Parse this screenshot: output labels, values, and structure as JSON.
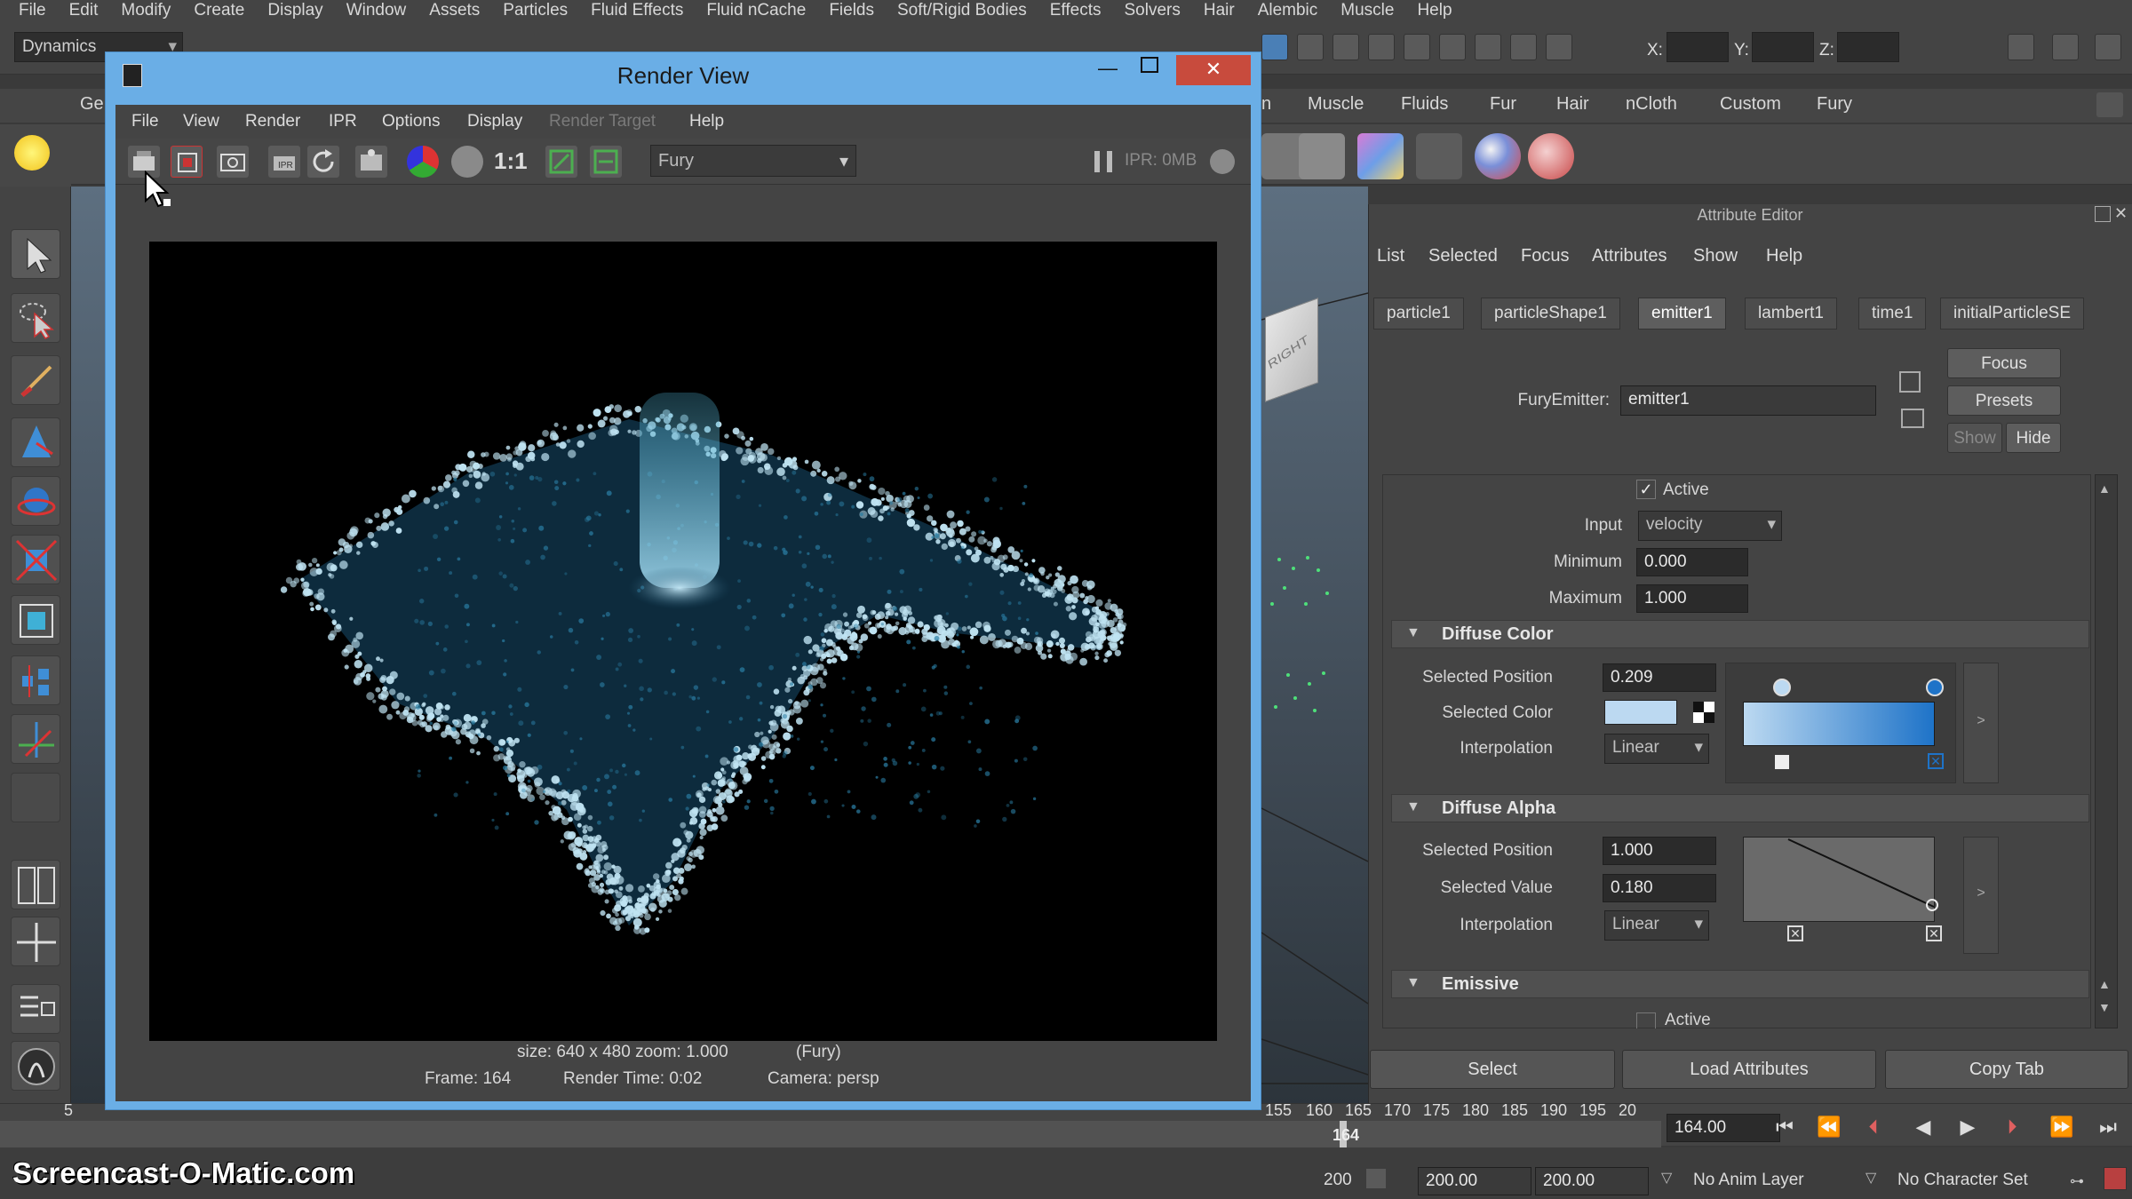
{
  "main_menu": [
    "File",
    "Edit",
    "Modify",
    "Create",
    "Display",
    "Window",
    "Assets",
    "Particles",
    "Fluid Effects",
    "Fluid nCache",
    "Fields",
    "Soft/Rigid Bodies",
    "Effects",
    "Solvers",
    "Hair",
    "Alembic",
    "Muscle",
    "Help"
  ],
  "status_line": {
    "menu_set": "Dynamics",
    "x_label": "X:",
    "y_label": "Y:",
    "z_label": "Z:"
  },
  "shelf_tabs": [
    "Ge",
    "n",
    "Muscle",
    "Fluids",
    "Fur",
    "Hair",
    "nCloth",
    "Custom",
    "Fury"
  ],
  "render_view": {
    "title": "Render View",
    "menu": [
      "File",
      "View",
      "Render",
      "IPR",
      "Options",
      "Display",
      "Render Target",
      "Help"
    ],
    "ratio_label": "1:1",
    "renderer": "Fury",
    "ipr_status": "IPR: 0MB",
    "info_line1_size": "size: 640 x 480 zoom: 1.000",
    "info_line1_renderer": "(Fury)",
    "info_frame": "Frame: 164",
    "info_render_time": "Render Time: 0:02",
    "info_camera": "Camera: persp"
  },
  "viewcube_label": "RIGHT",
  "attribute_editor": {
    "title": "Attribute Editor",
    "menu": [
      "List",
      "Selected",
      "Focus",
      "Attributes",
      "Show",
      "Help"
    ],
    "tabs": [
      "particle1",
      "particleShape1",
      "emitter1",
      "lambert1",
      "time1",
      "initialParticleSE"
    ],
    "active_tab": "emitter1",
    "node_type_label": "FuryEmitter:",
    "node_name": "emitter1",
    "focus_button": "Focus",
    "presets_button": "Presets",
    "show_button": "Show",
    "hide_button": "Hide",
    "active_label": "Active",
    "input_label": "Input",
    "input_value": "velocity",
    "minimum_label": "Minimum",
    "minimum_value": "0.000",
    "maximum_label": "Maximum",
    "maximum_value": "1.000",
    "diffuse_color": {
      "section": "Diffuse Color",
      "sel_pos_label": "Selected Position",
      "sel_pos_value": "0.209",
      "sel_color_label": "Selected Color",
      "interp_label": "Interpolation",
      "interp_value": "Linear"
    },
    "diffuse_alpha": {
      "section": "Diffuse Alpha",
      "sel_pos_label": "Selected Position",
      "sel_pos_value": "1.000",
      "sel_val_label": "Selected Value",
      "sel_val_value": "0.180",
      "interp_label": "Interpolation",
      "interp_value": "Linear"
    },
    "emissive": {
      "section": "Emissive",
      "active_label": "Active"
    },
    "select_button": "Select",
    "load_button": "Load Attributes",
    "copy_button": "Copy Tab"
  },
  "timeline": {
    "labels": [
      "5",
      "155",
      "160",
      "165",
      "170",
      "175",
      "180",
      "185",
      "190",
      "195",
      "20"
    ],
    "current_frame_marker": "164",
    "current_time": "164.00",
    "range_end": "200",
    "start_field": "200.00",
    "end_field": "200.00",
    "anim_layer": "No Anim Layer",
    "character_set": "No Character Set"
  },
  "watermark": "Screencast-O-Matic.com",
  "colors": {
    "window_frame": "#6aaee6",
    "close_button": "#c84b3d",
    "particle": "#bfe3f2",
    "gradient_start": "#bcd9f1",
    "gradient_end": "#1e73c8"
  }
}
